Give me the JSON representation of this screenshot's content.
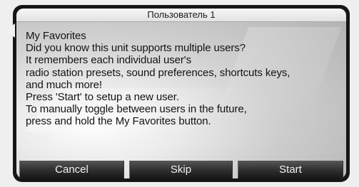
{
  "dialog": {
    "title": "Пользователь 1",
    "message_lines": [
      "My Favorites",
      "Did you know this unit supports multiple users?",
      "It remembers each individual user's",
      "radio station presets, sound preferences, shortcuts keys,",
      "and much more!",
      "Press 'Start' to setup a new user.",
      "To manually toggle between users in the future,",
      "press and hold the My Favorites button."
    ],
    "buttons": {
      "cancel": "Cancel",
      "skip": "Skip",
      "start": "Start"
    }
  },
  "icons": {
    "back": "back-arrow-icon"
  }
}
